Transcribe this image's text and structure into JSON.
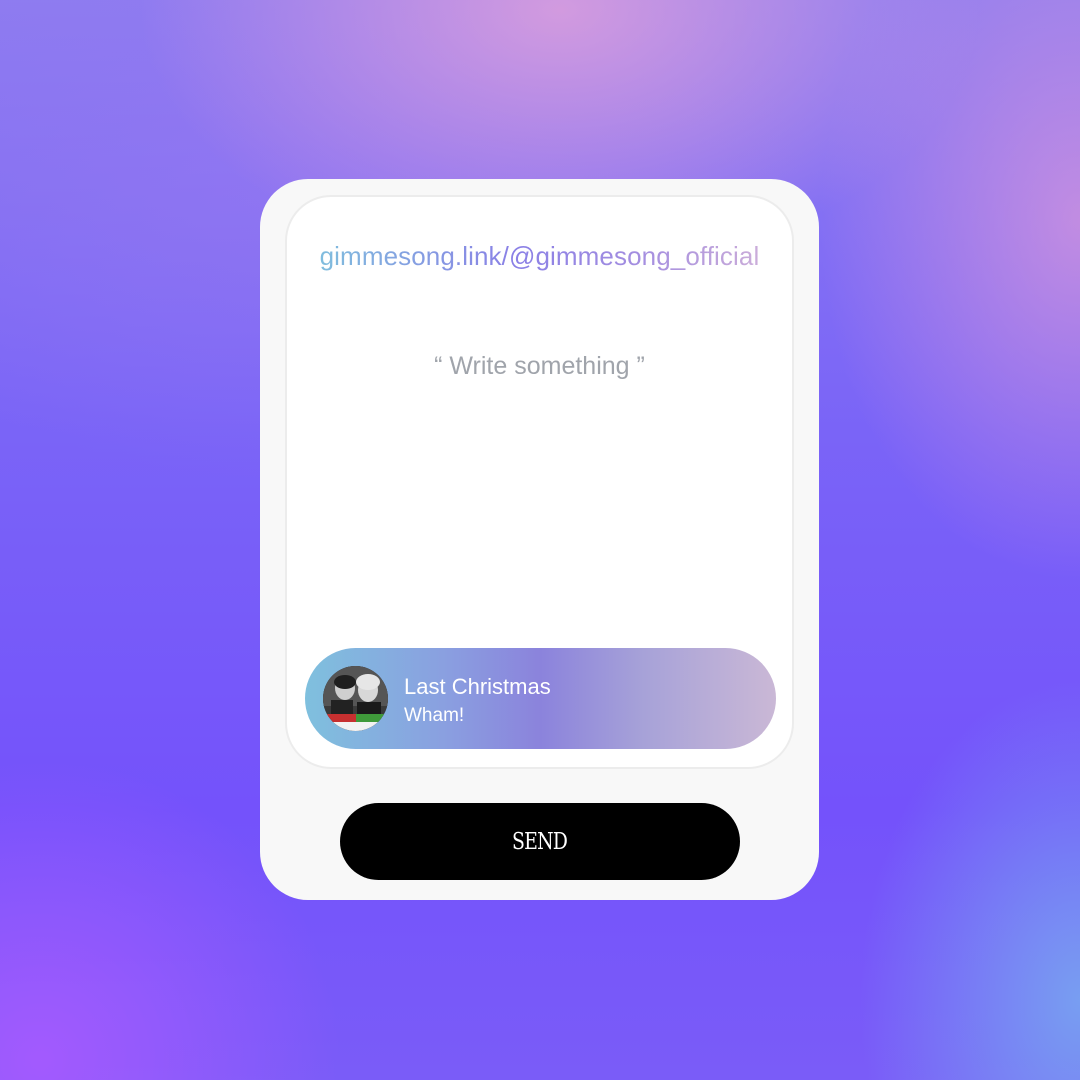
{
  "card": {
    "link": "gimmesong.link/@gimmesong_official",
    "message_placeholder": "“ Write something ”"
  },
  "song": {
    "title": "Last Christmas",
    "artist": "Wham!",
    "album_art_icon": "album-cover-image"
  },
  "actions": {
    "send_label": "SEND"
  },
  "colors": {
    "send_button": "#000000",
    "link_gradient": [
      "#7ec7dc",
      "#8a80e6",
      "#d5b5d8"
    ],
    "pill_gradient": [
      "#7fc0de",
      "#8b83dc",
      "#cab8d6"
    ]
  }
}
